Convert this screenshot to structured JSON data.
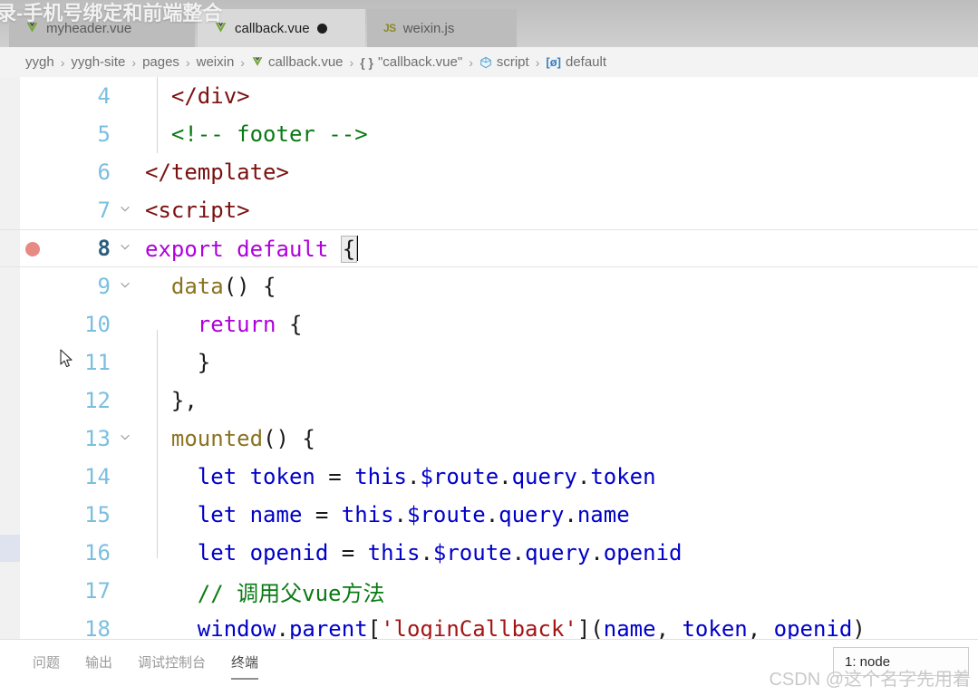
{
  "overlay": {
    "video_title": "录-手机号绑定和前端整合"
  },
  "tabs": [
    {
      "label": "myheader.vue",
      "icon": "vue-icon",
      "active": false,
      "dirty": false
    },
    {
      "label": "callback.vue",
      "icon": "vue-icon",
      "active": true,
      "dirty": true
    },
    {
      "label": "weixin.js",
      "icon": "js-icon",
      "active": false,
      "dirty": false
    }
  ],
  "breadcrumb": {
    "items": [
      {
        "label": "yygh",
        "icon": ""
      },
      {
        "label": "yygh-site",
        "icon": ""
      },
      {
        "label": "pages",
        "icon": ""
      },
      {
        "label": "weixin",
        "icon": ""
      },
      {
        "label": "callback.vue",
        "icon": "vue-icon"
      },
      {
        "label": "\"callback.vue\"",
        "icon": "braces-icon"
      },
      {
        "label": "script",
        "icon": "namespace-icon"
      },
      {
        "label": "default",
        "icon": "field-icon"
      }
    ],
    "separator": "›"
  },
  "editor": {
    "language": "vue",
    "active_line": 8,
    "breakpoint_line": 8,
    "cursor": {
      "line": 8,
      "after": "{"
    },
    "lines": [
      {
        "n": "4",
        "fold": "",
        "text": "  </div>"
      },
      {
        "n": "5",
        "fold": "",
        "text": "  <!-- footer -->"
      },
      {
        "n": "6",
        "fold": "",
        "text": "</template>"
      },
      {
        "n": "7",
        "fold": "v",
        "text": "<script>"
      },
      {
        "n": "8",
        "fold": "v",
        "text": "export default {"
      },
      {
        "n": "9",
        "fold": "v",
        "text": "  data() {"
      },
      {
        "n": "10",
        "fold": "",
        "text": "    return {"
      },
      {
        "n": "11",
        "fold": "",
        "text": "    }"
      },
      {
        "n": "12",
        "fold": "",
        "text": "  },"
      },
      {
        "n": "13",
        "fold": "v",
        "text": "  mounted() {"
      },
      {
        "n": "14",
        "fold": "",
        "text": "    let token = this.$route.query.token"
      },
      {
        "n": "15",
        "fold": "",
        "text": "    let name = this.$route.query.name"
      },
      {
        "n": "16",
        "fold": "",
        "text": "    let openid = this.$route.query.openid"
      },
      {
        "n": "17",
        "fold": "",
        "text": "    // 调用父vue方法"
      },
      {
        "n": "18",
        "fold": "",
        "text": "    window.parent['loginCallback'](name, token, openid)"
      }
    ]
  },
  "panel": {
    "tabs": [
      {
        "label": "问题",
        "selected": false
      },
      {
        "label": "输出",
        "selected": false
      },
      {
        "label": "调试控制台",
        "selected": false
      },
      {
        "label": "终端",
        "selected": true
      }
    ],
    "terminal_select": "1: node"
  },
  "watermark": "CSDN @这个名字先用着",
  "colors": {
    "tag": "#7b1010",
    "comment": "#0a7a14",
    "keyword": "#af00db",
    "function": "#8a7320",
    "variable": "#0000c8",
    "string": "#a31515",
    "linenumber": "#7bbfe0",
    "breakpoint": "#e88a84",
    "tabbar_bg": "#c4c4c4",
    "breadcrumb_bg": "#f3f3f3"
  }
}
